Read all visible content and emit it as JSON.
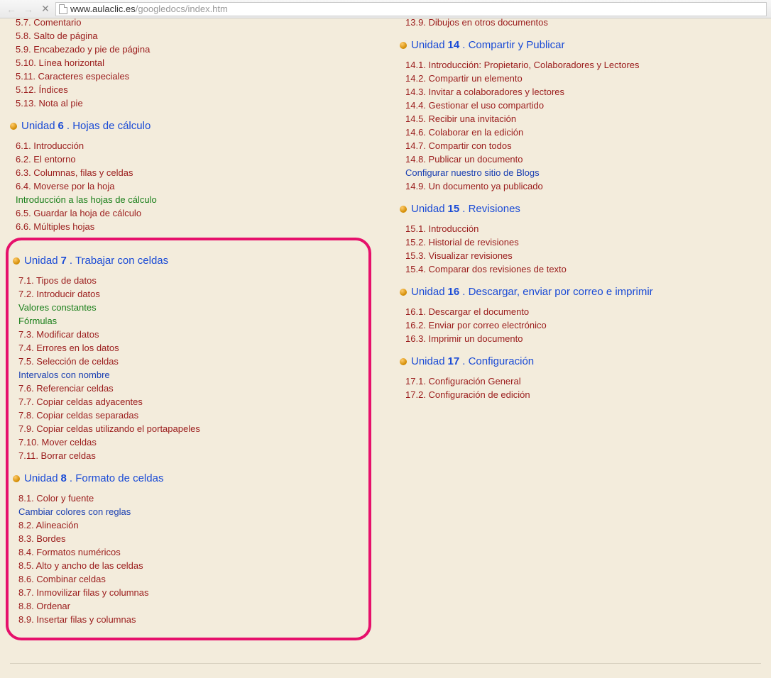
{
  "url": {
    "host": "www.aulaclic.es",
    "path": "/googledocs/index.htm"
  },
  "unit_prefix": "Unidad ",
  "left": {
    "cut5": [
      "5.7. Comentario",
      "5.8. Salto de página",
      "5.9. Encabezado y pie de página",
      "5.10. Línea horizontal",
      "5.11. Caracteres especiales",
      "5.12. Índices",
      "5.13. Nota al pie"
    ],
    "u6": {
      "num": "6",
      "title": ". Hojas de cálculo",
      "items": [
        {
          "t": "6.1. Introducción"
        },
        {
          "t": "6.2. El entorno"
        },
        {
          "t": "6.3. Columnas, filas y celdas"
        },
        {
          "t": "6.4. Moverse por la hoja"
        },
        {
          "t": "Introducción a las hojas de cálculo",
          "c": "green"
        },
        {
          "t": "6.5. Guardar la hoja de cálculo"
        },
        {
          "t": "6.6. Múltiples hojas"
        }
      ]
    },
    "u7": {
      "num": "7",
      "title": ". Trabajar con celdas",
      "items": [
        {
          "t": "7.1. Tipos de datos"
        },
        {
          "t": "7.2. Introducir datos"
        },
        {
          "t": "Valores constantes",
          "c": "green"
        },
        {
          "t": "Fórmulas",
          "c": "green"
        },
        {
          "t": "7.3. Modificar datos"
        },
        {
          "t": "7.4. Errores en los datos"
        },
        {
          "t": "7.5. Selección de celdas"
        },
        {
          "t": "Intervalos con nombre",
          "c": "blue"
        },
        {
          "t": "7.6. Referenciar celdas"
        },
        {
          "t": "7.7. Copiar celdas adyacentes"
        },
        {
          "t": "7.8. Copiar celdas separadas"
        },
        {
          "t": "7.9. Copiar celdas utilizando el portapapeles"
        },
        {
          "t": "7.10. Mover celdas"
        },
        {
          "t": "7.11. Borrar celdas"
        }
      ]
    },
    "u8": {
      "num": "8",
      "title": ". Formato de celdas",
      "items": [
        {
          "t": "8.1. Color y fuente"
        },
        {
          "t": "Cambiar colores con reglas",
          "c": "blue"
        },
        {
          "t": "8.2. Alineación"
        },
        {
          "t": "8.3. Bordes"
        },
        {
          "t": "8.4. Formatos numéricos"
        },
        {
          "t": "8.5. Alto y ancho de las celdas"
        },
        {
          "t": "8.6. Combinar celdas"
        },
        {
          "t": "8.7. Inmovilizar filas y columnas"
        },
        {
          "t": "8.8. Ordenar"
        },
        {
          "t": "8.9. Insertar filas y columnas"
        }
      ]
    }
  },
  "right": {
    "cut13": [
      "13.9. Dibujos en otros documentos"
    ],
    "u14": {
      "num": "14",
      "title": ". Compartir y Publicar",
      "items": [
        {
          "t": "14.1. Introducción: Propietario, Colaboradores y Lectores"
        },
        {
          "t": "14.2. Compartir un elemento"
        },
        {
          "t": "14.3. Invitar a colaboradores y lectores"
        },
        {
          "t": "14.4. Gestionar el uso compartido"
        },
        {
          "t": "14.5. Recibir una invitación"
        },
        {
          "t": "14.6. Colaborar en la edición"
        },
        {
          "t": "14.7. Compartir con todos"
        },
        {
          "t": "14.8. Publicar un documento"
        },
        {
          "t": "Configurar nuestro sitio de Blogs",
          "c": "blue"
        },
        {
          "t": "14.9. Un documento ya publicado"
        }
      ]
    },
    "u15": {
      "num": "15",
      "title": ". Revisiones",
      "items": [
        {
          "t": "15.1. Introducción"
        },
        {
          "t": "15.2. Historial de revisiones"
        },
        {
          "t": "15.3. Visualizar revisiones"
        },
        {
          "t": "15.4. Comparar dos revisiones de texto"
        }
      ]
    },
    "u16": {
      "num": "16",
      "title": ". Descargar, enviar por correo e imprimir",
      "items": [
        {
          "t": "16.1. Descargar el documento"
        },
        {
          "t": "16.2. Enviar por correo electrónico"
        },
        {
          "t": "16.3. Imprimir un documento"
        }
      ]
    },
    "u17": {
      "num": "17",
      "title": ". Configuración",
      "items": [
        {
          "t": "17.1. Configuración General"
        },
        {
          "t": "17.2. Configuración de edición"
        }
      ]
    }
  }
}
